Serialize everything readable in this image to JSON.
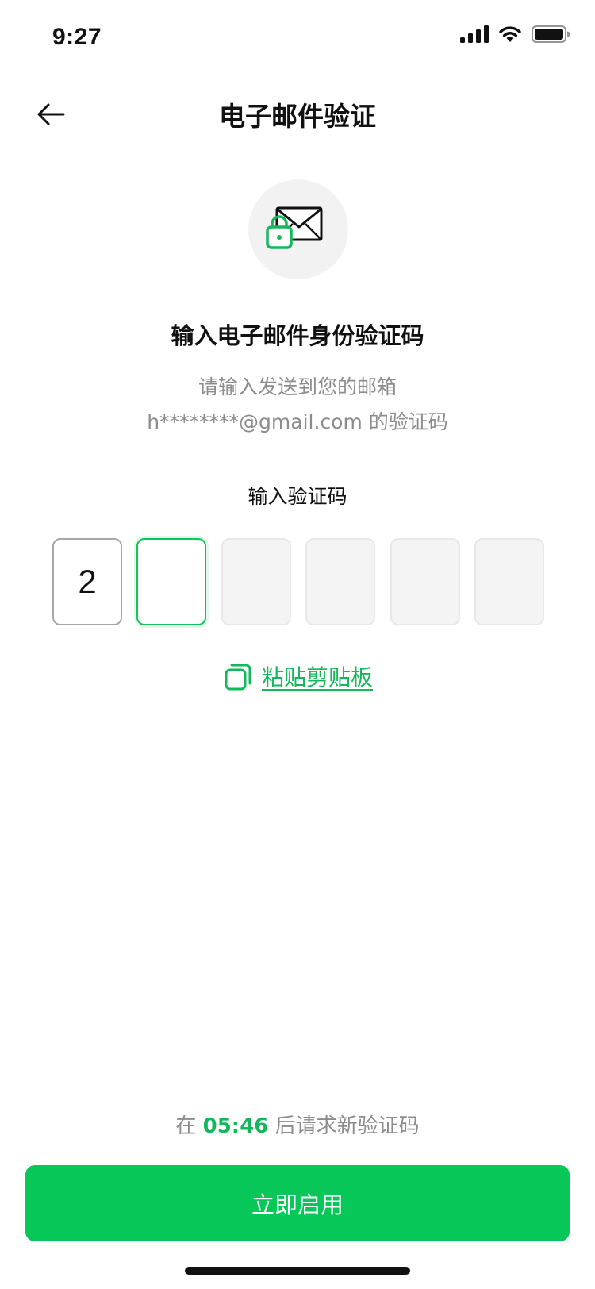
{
  "status_bar": {
    "time": "9:27"
  },
  "nav": {
    "title": "电子邮件验证"
  },
  "content": {
    "heading": "输入电子邮件身份验证码",
    "desc_line1": "请输入发送到您的邮箱",
    "desc_line2": "h********@gmail.com 的验证码",
    "code_label": "输入验证码",
    "code_digits": [
      "2",
      "",
      "",
      "",
      "",
      ""
    ],
    "paste_label": "粘贴剪贴板"
  },
  "resend": {
    "prefix": "在",
    "timer": "05:46",
    "suffix": "后请求新验证码"
  },
  "primary_button": {
    "label": "立即启用"
  },
  "colors": {
    "accent": "#07c758",
    "link": "#12b85a",
    "muted_text": "#8c8c8c",
    "code_box_bg": "#f4f4f4"
  }
}
